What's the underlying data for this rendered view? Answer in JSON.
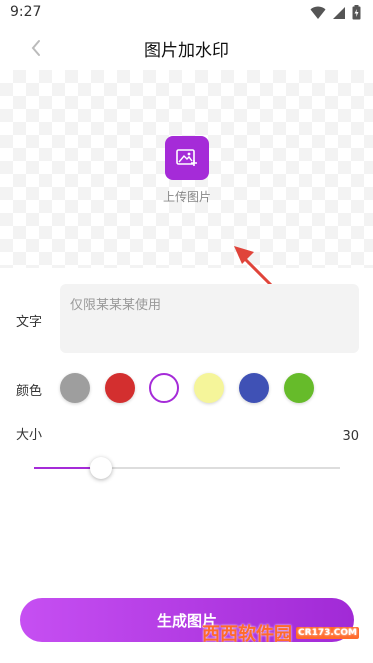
{
  "status_bar": {
    "time": "9:27"
  },
  "nav": {
    "title": "图片加水印"
  },
  "upload": {
    "label": "上传图片"
  },
  "text_field": {
    "label": "文字",
    "placeholder": "仅限某某某使用"
  },
  "color_picker": {
    "label": "颜色",
    "swatches": [
      {
        "name": "gray",
        "color": "#9e9e9e",
        "selected": false
      },
      {
        "name": "red",
        "color": "#d32f2f",
        "selected": false
      },
      {
        "name": "white",
        "color": "#ffffff",
        "selected": true
      },
      {
        "name": "light-yellow",
        "color": "#f5f59a",
        "selected": false
      },
      {
        "name": "blue",
        "color": "#3f51b5",
        "selected": false
      },
      {
        "name": "green",
        "color": "#66bb2a",
        "selected": false
      }
    ]
  },
  "size": {
    "label": "大小",
    "value": "30",
    "fraction": 0.22
  },
  "generate_button": {
    "label": "生成图片"
  },
  "watermark": {
    "brand": "西西软件园",
    "site": "CR173.COM"
  },
  "colors": {
    "accent": "#a52bd8",
    "arrow": "#e0443a"
  }
}
